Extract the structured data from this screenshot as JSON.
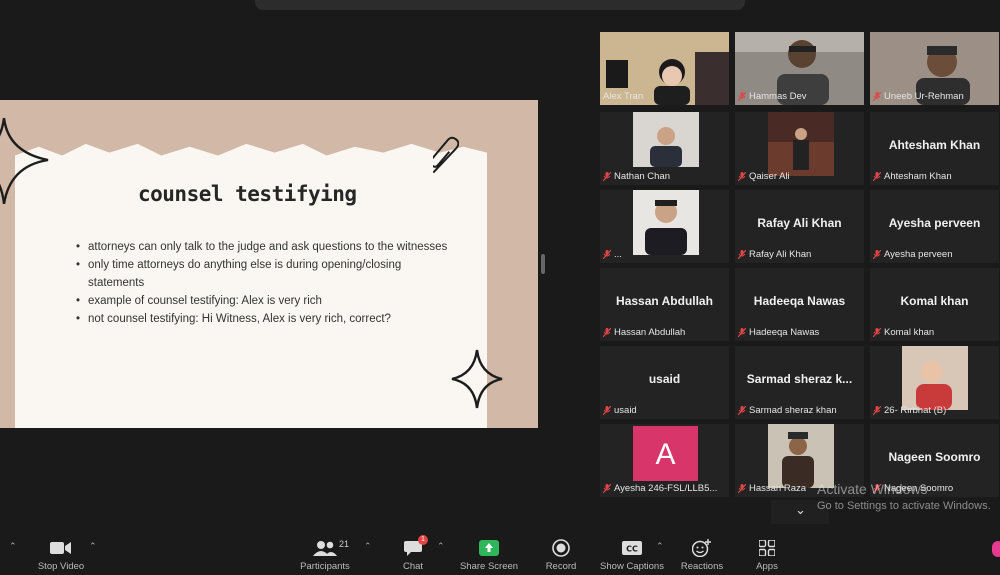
{
  "slide": {
    "title": "counsel testifying",
    "bullets": [
      "attorneys can only talk to the judge and ask questions to the witnesses",
      "only time attorneys do anything else is during opening/closing statements",
      "example of counsel testifying: Alex is very rich",
      "not counsel testifying: Hi Witness, Alex is very rich, correct?"
    ]
  },
  "participants": [
    {
      "name": "Alex Tran",
      "type": "video"
    },
    {
      "name": "Hammas Dev",
      "type": "video"
    },
    {
      "name": "Uneeb Ur-Rehman",
      "type": "video"
    },
    {
      "name": "Nathan Chan",
      "type": "video"
    },
    {
      "name": "Qaiser Ali",
      "type": "video"
    },
    {
      "name": "Ahtesham Khan",
      "type": "name"
    },
    {
      "name": "...",
      "type": "video"
    },
    {
      "name": "Rafay Ali Khan",
      "type": "name"
    },
    {
      "name": "Ayesha perveen",
      "type": "name"
    },
    {
      "name": "Hassan Abdullah",
      "type": "name"
    },
    {
      "name": "Hadeeqa Nawas",
      "type": "name"
    },
    {
      "name": "Komal khan",
      "type": "name"
    },
    {
      "name": "usaid",
      "type": "name"
    },
    {
      "name": "Sarmad sheraz khan",
      "display": "Sarmad sheraz k...",
      "type": "name"
    },
    {
      "name": "26- Rirbhat (B)",
      "type": "video"
    },
    {
      "name": "Ayesha 246-FSL/LLB5...",
      "type": "avatar",
      "initial": "A"
    },
    {
      "name": "Hassan Raza",
      "type": "video"
    },
    {
      "name": "Nageen Soomro",
      "type": "name"
    }
  ],
  "watermark": {
    "line1": "Activate Windows",
    "line2": "Go to Settings to activate Windows."
  },
  "toolbar": {
    "stop_video": "Stop Video",
    "participants": "Participants",
    "participants_count": "21",
    "chat": "Chat",
    "chat_badge": "1",
    "share_screen": "Share Screen",
    "record": "Record",
    "show_captions": "Show Captions",
    "reactions": "Reactions",
    "apps": "Apps"
  },
  "colors": {
    "active_speaker": "#f2c94c",
    "share_green": "#2fb55a",
    "avatar_pink": "#d8356b",
    "slide_bg": "#d2b8a6"
  }
}
